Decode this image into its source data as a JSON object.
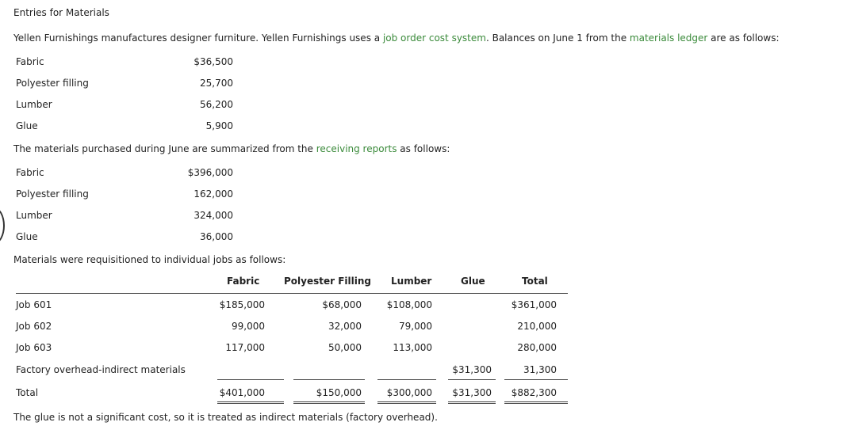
{
  "title": "Entries for Materials",
  "intro": {
    "part1": "Yellen Furnishings manufactures designer furniture. Yellen Furnishings uses a ",
    "link1": "job order cost system",
    "part2": ". Balances on June 1 from the ",
    "link2": "materials ledger",
    "part3": " are as follows:"
  },
  "balances": [
    {
      "label": "Fabric",
      "value": "$36,500"
    },
    {
      "label": "Polyester filling",
      "value": "25,700"
    },
    {
      "label": "Lumber",
      "value": "56,200"
    },
    {
      "label": "Glue",
      "value": "5,900"
    }
  ],
  "purchased_intro": {
    "part1": "The materials purchased during June are summarized from the ",
    "link": "receiving reports",
    "part2": " as follows:"
  },
  "purchases": [
    {
      "label": "Fabric",
      "value": "$396,000"
    },
    {
      "label": "Polyester filling",
      "value": "162,000"
    },
    {
      "label": "Lumber",
      "value": "324,000"
    },
    {
      "label": "Glue",
      "value": "36,000"
    }
  ],
  "requisition_intro": "Materials were requisitioned to individual jobs as follows:",
  "requisition_table": {
    "headers": [
      "Fabric",
      "Polyester Filling",
      "Lumber",
      "Glue",
      "Total"
    ],
    "rows": [
      {
        "label": "Job 601",
        "cells": [
          "$185,000",
          "$68,000",
          "$108,000",
          "",
          "$361,000"
        ]
      },
      {
        "label": "Job 602",
        "cells": [
          "99,000",
          "32,000",
          "79,000",
          "",
          "210,000"
        ]
      },
      {
        "label": "Job 603",
        "cells": [
          "117,000",
          "50,000",
          "113,000",
          "",
          "280,000"
        ]
      },
      {
        "label": "Factory overhead-indirect materials",
        "cells": [
          "",
          "",
          "",
          "$31,300",
          "31,300"
        ]
      },
      {
        "label": "Total",
        "cells": [
          "$401,000",
          "$150,000",
          "$300,000",
          "$31,300",
          "$882,300"
        ]
      }
    ]
  },
  "footer_note": "The glue is not a significant cost, so it is treated as indirect materials (factory overhead).",
  "colors": {
    "link": "#3a8a3a",
    "text": "#222222"
  }
}
